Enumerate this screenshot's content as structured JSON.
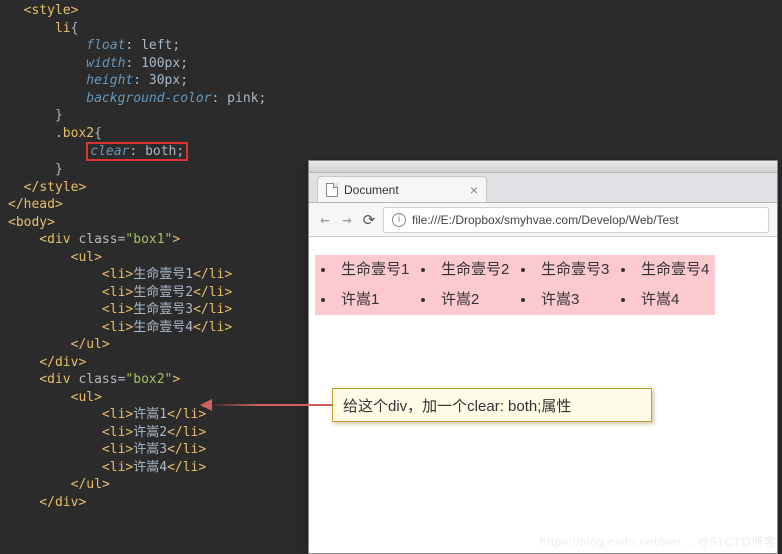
{
  "code": {
    "lines": [
      [
        [
          "tag-angle",
          "  <"
        ],
        [
          "tag-name",
          "style"
        ],
        [
          "tag-angle",
          ">"
        ]
      ],
      [
        [
          "css-selector",
          "      li"
        ],
        [
          "text-content",
          "{"
        ]
      ],
      [
        [
          "text-content",
          "          "
        ],
        [
          "css-prop",
          "float"
        ],
        [
          "text-content",
          ": "
        ],
        [
          "css-value",
          "left"
        ],
        [
          "text-content",
          ";"
        ]
      ],
      [
        [
          "text-content",
          "          "
        ],
        [
          "css-prop",
          "width"
        ],
        [
          "text-content",
          ": "
        ],
        [
          "css-value",
          "100px"
        ],
        [
          "text-content",
          ";"
        ]
      ],
      [
        [
          "text-content",
          "          "
        ],
        [
          "css-prop",
          "height"
        ],
        [
          "text-content",
          ": "
        ],
        [
          "css-value",
          "30px"
        ],
        [
          "text-content",
          ";"
        ]
      ],
      [
        [
          "text-content",
          "          "
        ],
        [
          "css-prop",
          "background-color"
        ],
        [
          "text-content",
          ": "
        ],
        [
          "css-value",
          "pink"
        ],
        [
          "text-content",
          ";"
        ]
      ],
      [
        [
          "text-content",
          "      }"
        ]
      ],
      [
        [
          "css-selector",
          "      .box2"
        ],
        [
          "text-content",
          "{"
        ]
      ],
      [
        [
          "text-content",
          "          REDBOX_START"
        ],
        [
          "css-prop",
          "clear"
        ],
        [
          "text-content",
          ": "
        ],
        [
          "css-value",
          "both"
        ],
        [
          "text-content",
          ";REDBOX_END"
        ]
      ],
      [
        [
          "text-content",
          "      }"
        ]
      ],
      [
        [
          "tag-angle",
          "  </"
        ],
        [
          "tag-name",
          "style"
        ],
        [
          "tag-angle",
          ">"
        ]
      ],
      [
        [
          "tag-angle",
          "</"
        ],
        [
          "tag-name",
          "head"
        ],
        [
          "tag-angle",
          ">"
        ]
      ],
      [
        [
          "tag-angle",
          "<"
        ],
        [
          "tag-name",
          "body"
        ],
        [
          "tag-angle",
          ">"
        ]
      ],
      [
        [
          "tag-angle",
          "    <"
        ],
        [
          "tag-name",
          "div "
        ],
        [
          "attr-name",
          "class"
        ],
        [
          "text-content",
          "="
        ],
        [
          "attr-value",
          "\"box1\""
        ],
        [
          "tag-angle",
          ">"
        ]
      ],
      [
        [
          "tag-angle",
          "        <"
        ],
        [
          "tag-name",
          "ul"
        ],
        [
          "tag-angle",
          ">"
        ]
      ],
      [
        [
          "tag-angle",
          "            <"
        ],
        [
          "tag-name",
          "li"
        ],
        [
          "tag-angle",
          ">"
        ],
        [
          "text-content",
          "生命壹号1"
        ],
        [
          "tag-angle",
          "</"
        ],
        [
          "tag-name",
          "li"
        ],
        [
          "tag-angle",
          ">"
        ]
      ],
      [
        [
          "tag-angle",
          "            <"
        ],
        [
          "tag-name",
          "li"
        ],
        [
          "tag-angle",
          ">"
        ],
        [
          "text-content",
          "生命壹号2"
        ],
        [
          "tag-angle",
          "</"
        ],
        [
          "tag-name",
          "li"
        ],
        [
          "tag-angle",
          ">"
        ]
      ],
      [
        [
          "tag-angle",
          "            <"
        ],
        [
          "tag-name",
          "li"
        ],
        [
          "tag-angle",
          ">"
        ],
        [
          "text-content",
          "生命壹号3"
        ],
        [
          "tag-angle",
          "</"
        ],
        [
          "tag-name",
          "li"
        ],
        [
          "tag-angle",
          ">"
        ]
      ],
      [
        [
          "tag-angle",
          "            <"
        ],
        [
          "tag-name",
          "li"
        ],
        [
          "tag-angle",
          ">"
        ],
        [
          "text-content",
          "生命壹号4"
        ],
        [
          "tag-angle",
          "</"
        ],
        [
          "tag-name",
          "li"
        ],
        [
          "tag-angle",
          ">"
        ]
      ],
      [
        [
          "tag-angle",
          "        </"
        ],
        [
          "tag-name",
          "ul"
        ],
        [
          "tag-angle",
          ">"
        ]
      ],
      [
        [
          "tag-angle",
          "    </"
        ],
        [
          "tag-name",
          "div"
        ],
        [
          "tag-angle",
          ">"
        ]
      ],
      [
        [
          "tag-angle",
          "    <"
        ],
        [
          "tag-name",
          "div "
        ],
        [
          "attr-name",
          "class"
        ],
        [
          "text-content",
          "="
        ],
        [
          "attr-value",
          "\"box2\""
        ],
        [
          "tag-angle",
          ">"
        ]
      ],
      [
        [
          "tag-angle",
          "        <"
        ],
        [
          "tag-name",
          "ul"
        ],
        [
          "tag-angle",
          ">"
        ]
      ],
      [
        [
          "tag-angle",
          "            <"
        ],
        [
          "tag-name",
          "li"
        ],
        [
          "tag-angle",
          ">"
        ],
        [
          "text-content",
          "许嵩1"
        ],
        [
          "tag-angle",
          "</"
        ],
        [
          "tag-name",
          "li"
        ],
        [
          "tag-angle",
          ">"
        ]
      ],
      [
        [
          "tag-angle",
          "            <"
        ],
        [
          "tag-name",
          "li"
        ],
        [
          "tag-angle",
          ">"
        ],
        [
          "text-content",
          "许嵩2"
        ],
        [
          "tag-angle",
          "</"
        ],
        [
          "tag-name",
          "li"
        ],
        [
          "tag-angle",
          ">"
        ]
      ],
      [
        [
          "tag-angle",
          "            <"
        ],
        [
          "tag-name",
          "li"
        ],
        [
          "tag-angle",
          ">"
        ],
        [
          "text-content",
          "许嵩3"
        ],
        [
          "tag-angle",
          "</"
        ],
        [
          "tag-name",
          "li"
        ],
        [
          "tag-angle",
          ">"
        ]
      ],
      [
        [
          "tag-angle",
          "            <"
        ],
        [
          "tag-name",
          "li"
        ],
        [
          "tag-angle",
          ">"
        ],
        [
          "text-content",
          "许嵩4"
        ],
        [
          "tag-angle",
          "</"
        ],
        [
          "tag-name",
          "li"
        ],
        [
          "tag-angle",
          ">"
        ]
      ],
      [
        [
          "tag-angle",
          "        </"
        ],
        [
          "tag-name",
          "ul"
        ],
        [
          "tag-angle",
          ">"
        ]
      ],
      [
        [
          "tag-angle",
          "    </"
        ],
        [
          "tag-name",
          "div"
        ],
        [
          "tag-angle",
          ">"
        ]
      ]
    ]
  },
  "browser": {
    "tab_title": "Document",
    "url": "file:///E:/Dropbox/smyhvae.com/Develop/Web/Test",
    "list1": [
      "生命壹号1",
      "生命壹号2",
      "生命壹号3",
      "生命壹号4"
    ],
    "list2": [
      "许嵩1",
      "许嵩2",
      "许嵩3",
      "许嵩4"
    ]
  },
  "callout": {
    "text": "给这个div，加一个clear: both;属性"
  },
  "watermark": "https://blog.csdn.net/wei …@51CTO博客"
}
